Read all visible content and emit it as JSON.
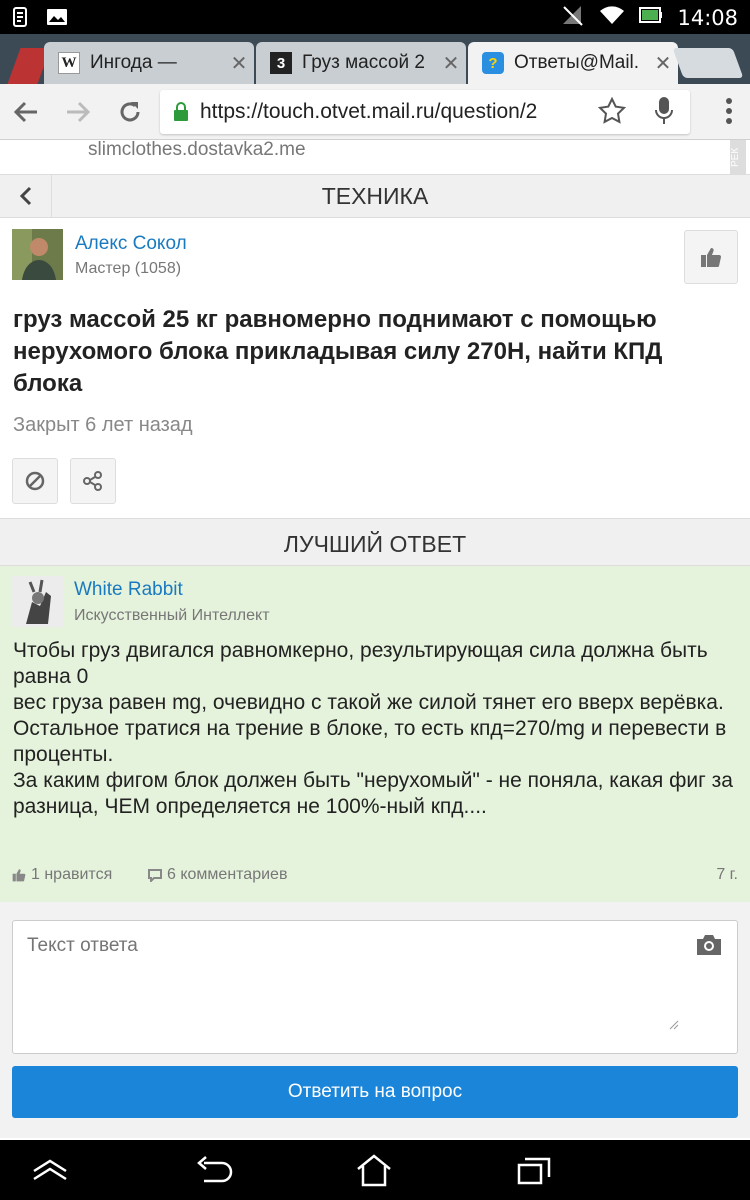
{
  "status_bar": {
    "time": "14:08"
  },
  "tabs": [
    {
      "title": "Ингода —",
      "favicon": "W"
    },
    {
      "title": "Груз массой 2",
      "favicon": "3"
    },
    {
      "title": "Ответы@Mail.",
      "favicon": "?"
    }
  ],
  "address_bar": {
    "url": "https://touch.otvet.mail.ru/question/2"
  },
  "ad": {
    "text": "slimclothes.dostavka2.me",
    "label": "РЕК"
  },
  "category": {
    "title": "ТЕХНИКА"
  },
  "question": {
    "author": {
      "name": "Алекс Сокол",
      "rank": "Мастер (1058)"
    },
    "title": "груз массой 25 кг равномерно поднимают с помощью нерухомого блока прикладывая силу 270Н, найти КПД блока",
    "status": "Закрыт 6 лет назад"
  },
  "best_answer": {
    "header": "ЛУЧШИЙ ОТВЕТ",
    "author": {
      "name": "White Rabbit",
      "rank": "Искусственный Интеллект"
    },
    "text": "Чтобы груз двигался равномкерно, результирующая сила должна быть равна 0\nвес груза равен mg, очевидно с такой же силой тянет его вверх верёвка.\nОстальное тратися на трение в блоке, то есть кпд=270/mg и перевести в проценты.\nЗа каким фигом блок должен быть \"нерухомый\" - не поняла, какая фиг за разница, ЧЕМ определяется не 100%-ный кпд....",
    "likes": "1 нравится",
    "comments": "6 комментариев",
    "age": "7 г."
  },
  "reply": {
    "placeholder": "Текст ответа",
    "submit_label": "Ответить на вопрос"
  }
}
